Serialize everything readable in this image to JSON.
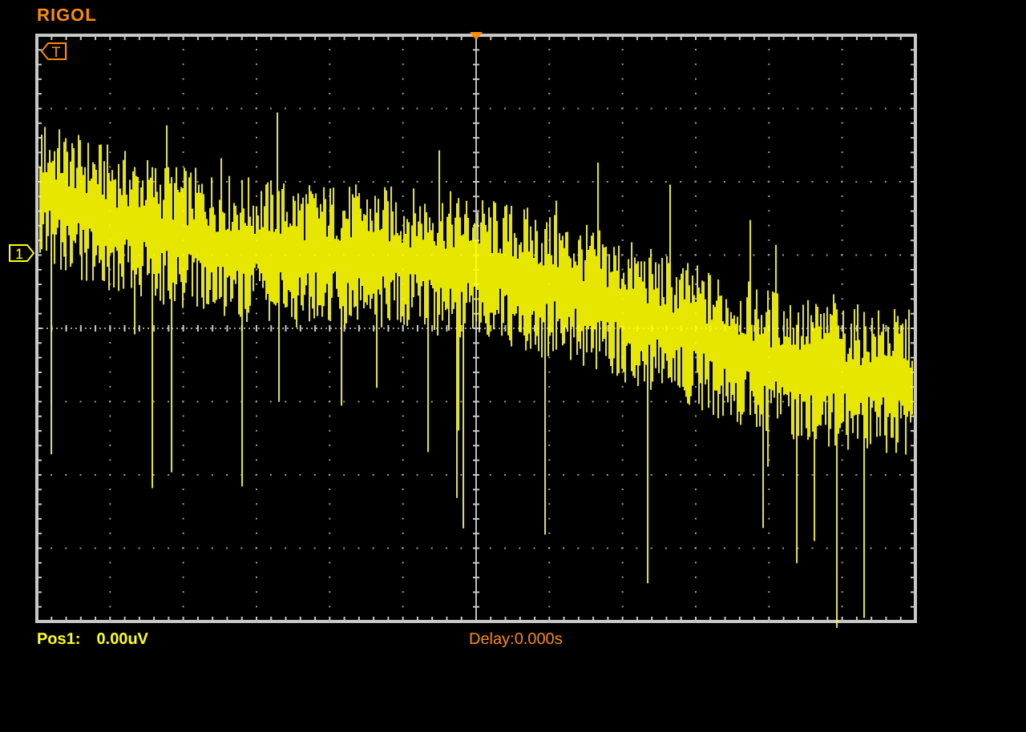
{
  "header": {
    "brand": "RIGOL"
  },
  "screen": {
    "trigger_marker": {
      "label": "T"
    },
    "channel_marker": {
      "label": "1"
    }
  },
  "status_bar": {
    "position_label": "Pos1:",
    "position_value": "0.00uV",
    "delay": "Delay:0.000s"
  }
}
